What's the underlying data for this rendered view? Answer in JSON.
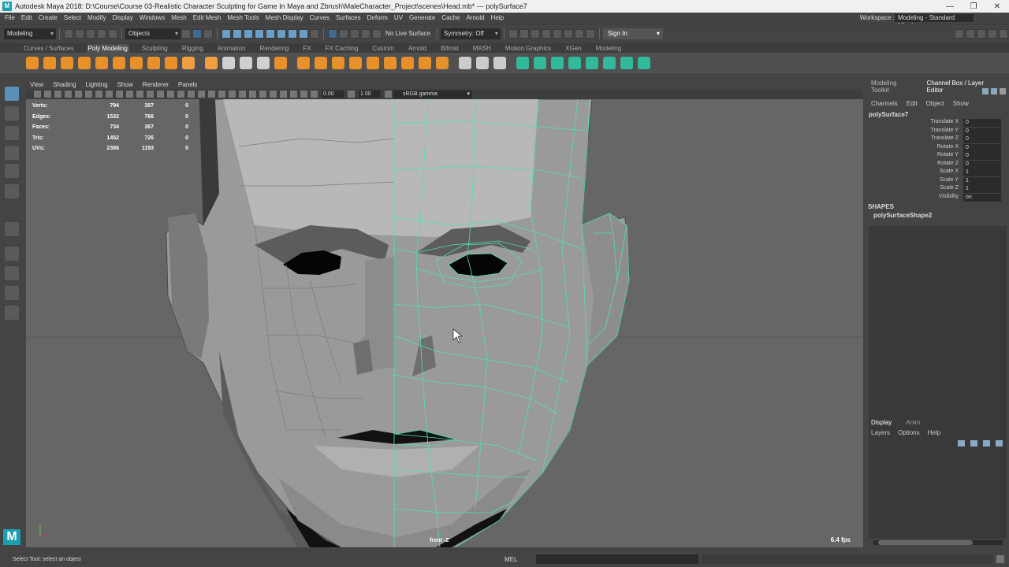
{
  "window": {
    "title": "Autodesk Maya 2018: D:\\Course\\Course 03-Realistic Character Sculpting for Game In Maya and Zbrush\\MaleCharacter_Project\\scenes\\Head.mb*   ---   polySurface7",
    "app_icon": "M"
  },
  "menubar": {
    "items": [
      "File",
      "Edit",
      "Create",
      "Select",
      "Modify",
      "Display",
      "Windows",
      "Mesh",
      "Edit Mesh",
      "Mesh Tools",
      "Mesh Display",
      "Curves",
      "Surfaces",
      "Deform",
      "UV",
      "Generate",
      "Cache",
      "Arnold",
      "Help"
    ],
    "workspace_label": "Workspace :",
    "workspace_value": "Modeling - Standard Mine*"
  },
  "statusline": {
    "mode": "Modeling",
    "selection_mode": "Objects",
    "live_surface": "No Live Surface",
    "symmetry": "Symmetry: Off",
    "sign_in": "Sign In"
  },
  "shelf": {
    "tabs": [
      "Curves / Surfaces",
      "Poly Modeling",
      "Sculpting",
      "Rigging",
      "Animation",
      "Rendering",
      "FX",
      "FX Caching",
      "Custom",
      "Arnold",
      "Bifrost",
      "MASH",
      "Motion Graphics",
      "XGen",
      "Modeling"
    ],
    "active_tab": "Poly Modeling",
    "icon_colors": [
      "#e8902a",
      "#e8902a",
      "#e8902a",
      "#e8902a",
      "#e8902a",
      "#e8902a",
      "#e8902a",
      "#e8902a",
      "#e8902a",
      "#f0a040",
      "#f0a040",
      "#d0d0d0",
      "#d0d0d0",
      "#d0d0d0",
      "#e8902a",
      "#e8902a",
      "#e8902a",
      "#e8902a",
      "#e8902a",
      "#e8902a",
      "#e8902a",
      "#e8902a",
      "#e8902a",
      "#e8902a",
      "#cccccc",
      "#cccccc",
      "#cccccc",
      "#32b89a",
      "#32b89a",
      "#32b89a",
      "#32b89a",
      "#32b89a",
      "#32b89a",
      "#32b89a",
      "#32b89a"
    ]
  },
  "viewport": {
    "menu": [
      "View",
      "Shading",
      "Lighting",
      "Show",
      "Renderer",
      "Panels"
    ],
    "exposure": "0.00",
    "gamma": "1.00",
    "color_space": "sRGB gamma",
    "hud": [
      {
        "label": "Verts:",
        "a": "794",
        "b": "397",
        "c": "0"
      },
      {
        "label": "Edges:",
        "a": "1532",
        "b": "766",
        "c": "0"
      },
      {
        "label": "Faces:",
        "a": "734",
        "b": "367",
        "c": "0"
      },
      {
        "label": "Tris:",
        "a": "1452",
        "b": "726",
        "c": "0"
      },
      {
        "label": "UVs:",
        "a": "2386",
        "b": "1193",
        "c": "0"
      }
    ],
    "camera_label": "front -Z",
    "fps": "6.4 fps",
    "wire_color": "#52e0b0"
  },
  "channelbox": {
    "tabs": [
      "Modeling Toolkit",
      "Channel Box / Layer Editor"
    ],
    "active_tab": "Channel Box / Layer Editor",
    "menu": [
      "Channels",
      "Edit",
      "Object",
      "Show"
    ],
    "object": "polySurface7",
    "attrs": [
      {
        "name": "Translate X",
        "value": "0"
      },
      {
        "name": "Translate Y",
        "value": "0"
      },
      {
        "name": "Translate Z",
        "value": "0"
      },
      {
        "name": "Rotate X",
        "value": "0"
      },
      {
        "name": "Rotate Y",
        "value": "0"
      },
      {
        "name": "Rotate Z",
        "value": "0"
      },
      {
        "name": "Scale X",
        "value": "1"
      },
      {
        "name": "Scale Y",
        "value": "1"
      },
      {
        "name": "Scale Z",
        "value": "1"
      },
      {
        "name": "Visibility",
        "value": "on"
      }
    ],
    "shapes_header": "SHAPES",
    "shape_name": "polySurfaceShape2"
  },
  "layereditor": {
    "tabs": [
      "Display",
      "Anim"
    ],
    "active_tab": "Display",
    "menu": [
      "Layers",
      "Options",
      "Help"
    ]
  },
  "commandline": {
    "help": "Select Tool: select an object",
    "mel": "MEL"
  }
}
